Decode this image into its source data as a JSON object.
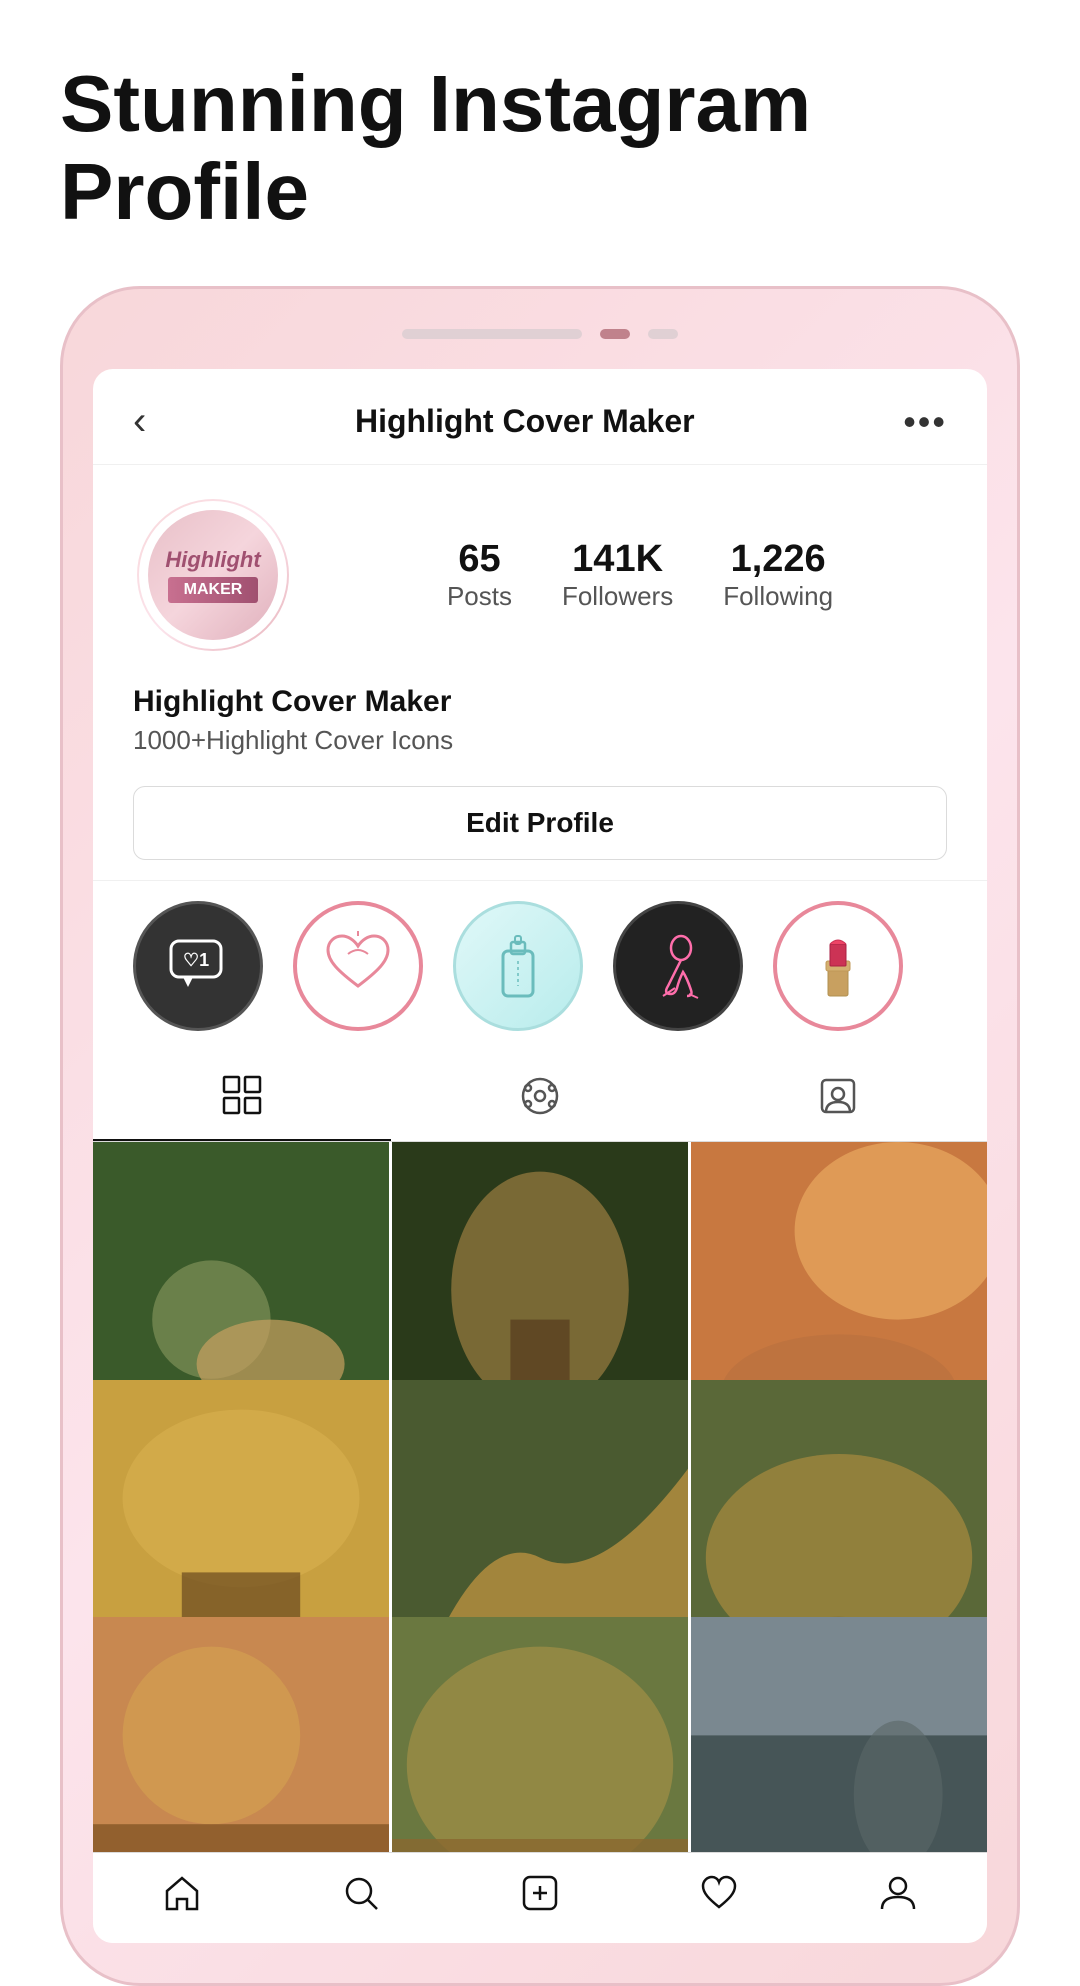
{
  "page": {
    "header_title": "Stunning Instagram Profile"
  },
  "pagination": {
    "dots": [
      "inactive",
      "active",
      "small"
    ]
  },
  "nav": {
    "back_label": "<",
    "title": "Highlight Cover Maker",
    "more_label": "..."
  },
  "profile": {
    "avatar_text": "Highlight",
    "stats": [
      {
        "number": "65",
        "label": "Posts"
      },
      {
        "number": "141K",
        "label": "Followers"
      },
      {
        "number": "1,226",
        "label": "Following"
      }
    ],
    "username": "Highlight Cover Maker",
    "bio": "1000+Highlight Cover Icons",
    "edit_button": "Edit Profile"
  },
  "highlights": [
    {
      "id": "notifications",
      "emoji": "💬",
      "style": "hl-notification"
    },
    {
      "id": "hearts",
      "emoji": "💕",
      "style": "hl-heart"
    },
    {
      "id": "perfume",
      "emoji": "🧴",
      "style": "hl-perfume"
    },
    {
      "id": "flamingo",
      "emoji": "🦩",
      "style": "hl-flamingo"
    },
    {
      "id": "lipstick",
      "emoji": "💄",
      "style": "hl-lipstick"
    }
  ],
  "tabs": [
    {
      "id": "grid",
      "icon": "grid",
      "active": true
    },
    {
      "id": "reels",
      "icon": "reels",
      "active": false
    },
    {
      "id": "tagged",
      "icon": "tagged",
      "active": false
    }
  ],
  "grid_photos": [
    {
      "id": 1,
      "style_class": "photo-1"
    },
    {
      "id": 2,
      "style_class": "photo-2"
    },
    {
      "id": 3,
      "style_class": "photo-3"
    },
    {
      "id": 4,
      "style_class": "photo-4"
    },
    {
      "id": 5,
      "style_class": "photo-5"
    },
    {
      "id": 6,
      "style_class": "photo-6"
    },
    {
      "id": 7,
      "style_class": "photo-7"
    },
    {
      "id": 8,
      "style_class": "photo-8"
    },
    {
      "id": 9,
      "style_class": "photo-9"
    }
  ],
  "bottom_nav": [
    {
      "id": "home",
      "icon": "home"
    },
    {
      "id": "search",
      "icon": "search"
    },
    {
      "id": "add",
      "icon": "plus-square"
    },
    {
      "id": "heart",
      "icon": "heart"
    },
    {
      "id": "profile",
      "icon": "person"
    }
  ]
}
